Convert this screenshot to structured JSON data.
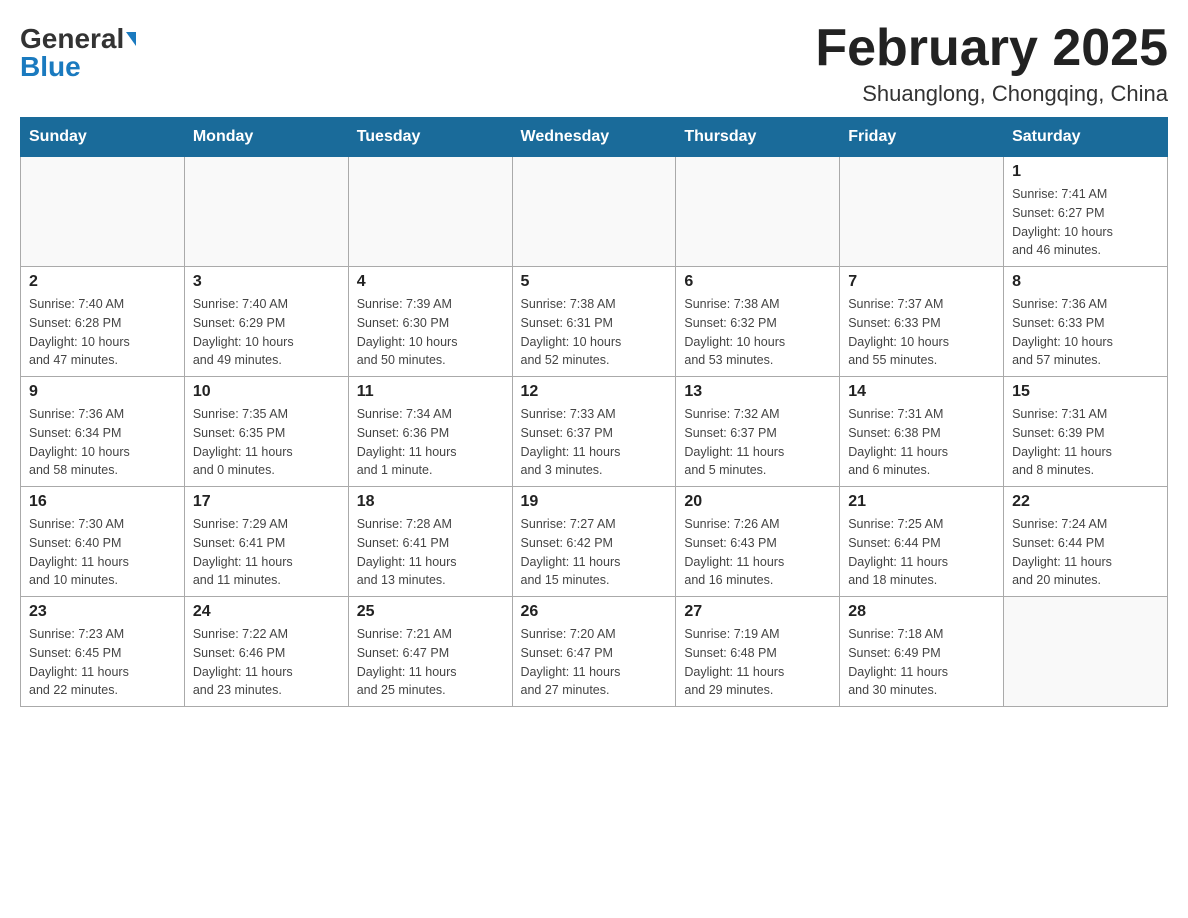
{
  "header": {
    "logo_general": "General",
    "logo_blue": "Blue",
    "month_title": "February 2025",
    "location": "Shuanglong, Chongqing, China"
  },
  "days_of_week": [
    "Sunday",
    "Monday",
    "Tuesday",
    "Wednesday",
    "Thursday",
    "Friday",
    "Saturday"
  ],
  "weeks": [
    [
      {
        "day": "",
        "info": ""
      },
      {
        "day": "",
        "info": ""
      },
      {
        "day": "",
        "info": ""
      },
      {
        "day": "",
        "info": ""
      },
      {
        "day": "",
        "info": ""
      },
      {
        "day": "",
        "info": ""
      },
      {
        "day": "1",
        "info": "Sunrise: 7:41 AM\nSunset: 6:27 PM\nDaylight: 10 hours\nand 46 minutes."
      }
    ],
    [
      {
        "day": "2",
        "info": "Sunrise: 7:40 AM\nSunset: 6:28 PM\nDaylight: 10 hours\nand 47 minutes."
      },
      {
        "day": "3",
        "info": "Sunrise: 7:40 AM\nSunset: 6:29 PM\nDaylight: 10 hours\nand 49 minutes."
      },
      {
        "day": "4",
        "info": "Sunrise: 7:39 AM\nSunset: 6:30 PM\nDaylight: 10 hours\nand 50 minutes."
      },
      {
        "day": "5",
        "info": "Sunrise: 7:38 AM\nSunset: 6:31 PM\nDaylight: 10 hours\nand 52 minutes."
      },
      {
        "day": "6",
        "info": "Sunrise: 7:38 AM\nSunset: 6:32 PM\nDaylight: 10 hours\nand 53 minutes."
      },
      {
        "day": "7",
        "info": "Sunrise: 7:37 AM\nSunset: 6:33 PM\nDaylight: 10 hours\nand 55 minutes."
      },
      {
        "day": "8",
        "info": "Sunrise: 7:36 AM\nSunset: 6:33 PM\nDaylight: 10 hours\nand 57 minutes."
      }
    ],
    [
      {
        "day": "9",
        "info": "Sunrise: 7:36 AM\nSunset: 6:34 PM\nDaylight: 10 hours\nand 58 minutes."
      },
      {
        "day": "10",
        "info": "Sunrise: 7:35 AM\nSunset: 6:35 PM\nDaylight: 11 hours\nand 0 minutes."
      },
      {
        "day": "11",
        "info": "Sunrise: 7:34 AM\nSunset: 6:36 PM\nDaylight: 11 hours\nand 1 minute."
      },
      {
        "day": "12",
        "info": "Sunrise: 7:33 AM\nSunset: 6:37 PM\nDaylight: 11 hours\nand 3 minutes."
      },
      {
        "day": "13",
        "info": "Sunrise: 7:32 AM\nSunset: 6:37 PM\nDaylight: 11 hours\nand 5 minutes."
      },
      {
        "day": "14",
        "info": "Sunrise: 7:31 AM\nSunset: 6:38 PM\nDaylight: 11 hours\nand 6 minutes."
      },
      {
        "day": "15",
        "info": "Sunrise: 7:31 AM\nSunset: 6:39 PM\nDaylight: 11 hours\nand 8 minutes."
      }
    ],
    [
      {
        "day": "16",
        "info": "Sunrise: 7:30 AM\nSunset: 6:40 PM\nDaylight: 11 hours\nand 10 minutes."
      },
      {
        "day": "17",
        "info": "Sunrise: 7:29 AM\nSunset: 6:41 PM\nDaylight: 11 hours\nand 11 minutes."
      },
      {
        "day": "18",
        "info": "Sunrise: 7:28 AM\nSunset: 6:41 PM\nDaylight: 11 hours\nand 13 minutes."
      },
      {
        "day": "19",
        "info": "Sunrise: 7:27 AM\nSunset: 6:42 PM\nDaylight: 11 hours\nand 15 minutes."
      },
      {
        "day": "20",
        "info": "Sunrise: 7:26 AM\nSunset: 6:43 PM\nDaylight: 11 hours\nand 16 minutes."
      },
      {
        "day": "21",
        "info": "Sunrise: 7:25 AM\nSunset: 6:44 PM\nDaylight: 11 hours\nand 18 minutes."
      },
      {
        "day": "22",
        "info": "Sunrise: 7:24 AM\nSunset: 6:44 PM\nDaylight: 11 hours\nand 20 minutes."
      }
    ],
    [
      {
        "day": "23",
        "info": "Sunrise: 7:23 AM\nSunset: 6:45 PM\nDaylight: 11 hours\nand 22 minutes."
      },
      {
        "day": "24",
        "info": "Sunrise: 7:22 AM\nSunset: 6:46 PM\nDaylight: 11 hours\nand 23 minutes."
      },
      {
        "day": "25",
        "info": "Sunrise: 7:21 AM\nSunset: 6:47 PM\nDaylight: 11 hours\nand 25 minutes."
      },
      {
        "day": "26",
        "info": "Sunrise: 7:20 AM\nSunset: 6:47 PM\nDaylight: 11 hours\nand 27 minutes."
      },
      {
        "day": "27",
        "info": "Sunrise: 7:19 AM\nSunset: 6:48 PM\nDaylight: 11 hours\nand 29 minutes."
      },
      {
        "day": "28",
        "info": "Sunrise: 7:18 AM\nSunset: 6:49 PM\nDaylight: 11 hours\nand 30 minutes."
      },
      {
        "day": "",
        "info": ""
      }
    ]
  ]
}
